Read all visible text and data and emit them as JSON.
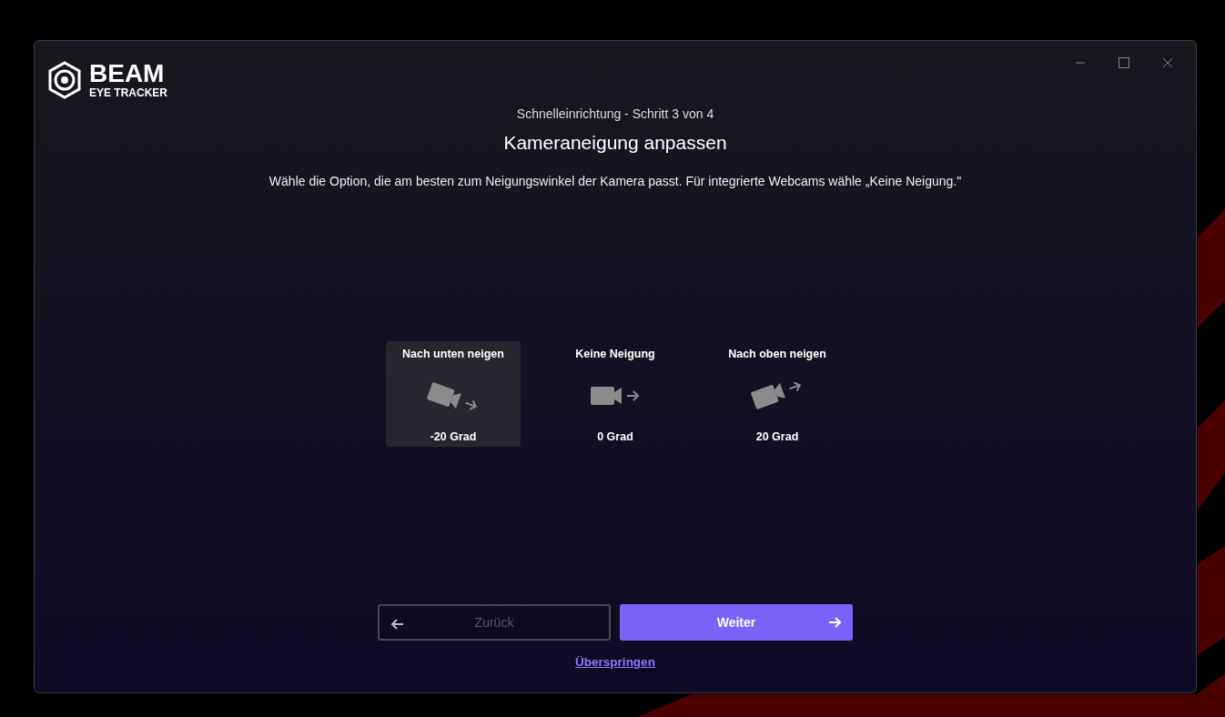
{
  "logo": {
    "name": "BEAM",
    "subtitle": "EYE TRACKER"
  },
  "step": "Schnelleinrichtung - Schritt 3 von 4",
  "title": "Kameraneigung anpassen",
  "description": "Wähle die Option, die am besten zum Neigungswinkel der Kamera passt. Für integrierte Webcams wähle „Keine Neigung.\"",
  "options": [
    {
      "kind": "down",
      "label": "Nach unten neigen",
      "value": "-20 Grad",
      "selected": true
    },
    {
      "kind": "none",
      "label": "Keine Neigung",
      "value": "0 Grad",
      "selected": false
    },
    {
      "kind": "up",
      "label": "Nach oben neigen",
      "value": "20 Grad",
      "selected": false
    }
  ],
  "back_button": {
    "label": "Zurück",
    "disabled": true
  },
  "next_button": {
    "label": "Weiter"
  },
  "skip_link": "Überspringen"
}
